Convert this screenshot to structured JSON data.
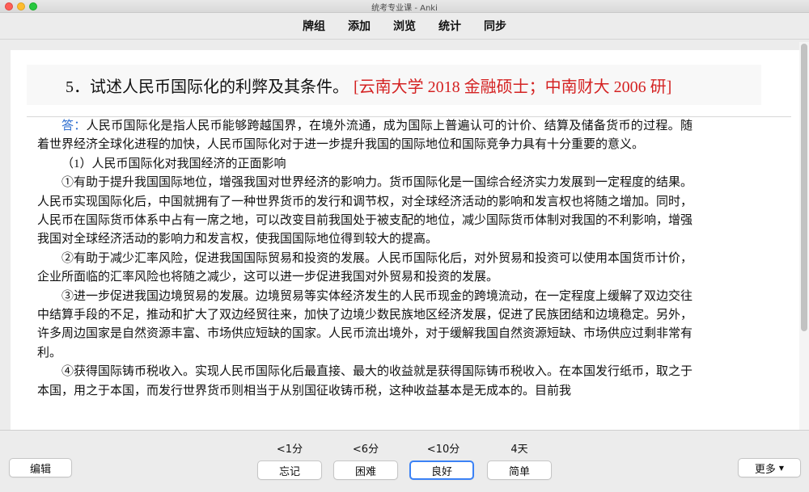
{
  "window": {
    "title": "统考专业课 - Anki"
  },
  "nav": {
    "items": [
      "牌组",
      "添加",
      "浏览",
      "统计",
      "同步"
    ]
  },
  "card": {
    "question": "5．试述人民币国际化的利弊及其条件。",
    "source": "[云南大学 2018 金融硕士；中南财大 2006 研]",
    "answer_label": "答：",
    "paragraphs": [
      "人民币国际化是指人民币能够跨越国界，在境外流通，成为国际上普遍认可的计价、结算及储备货币的过程。随着世界经济全球化进程的加快，人民币国际化对于进一步提升我国的国际地位和国际竞争力具有十分重要的意义。",
      "（1）人民币国际化对我国经济的正面影响",
      "①有助于提升我国国际地位，增强我国对世界经济的影响力。货币国际化是一国综合经济实力发展到一定程度的结果。人民币实现国际化后，中国就拥有了一种世界货币的发行和调节权，对全球经济活动的影响和发言权也将随之增加。同时，人民币在国际货币体系中占有一席之地，可以改变目前我国处于被支配的地位，减少国际货币体制对我国的不利影响，增强我国对全球经济活动的影响力和发言权，使我国国际地位得到较大的提高。",
      "②有助于减少汇率风险，促进我国国际贸易和投资的发展。人民币国际化后，对外贸易和投资可以使用本国货币计价，企业所面临的汇率风险也将随之减少，这可以进一步促进我国对外贸易和投资的发展。",
      "③进一步促进我国边境贸易的发展。边境贸易等实体经济发生的人民币现金的跨境流动，在一定程度上缓解了双边交往中结算手段的不足，推动和扩大了双边经贸往来，加快了边境少数民族地区经济发展，促进了民族团结和边境稳定。另外，许多周边国家是自然资源丰富、市场供应短缺的国家。人民币流出境外，对于缓解我国自然资源短缺、市场供应过剩非常有利。",
      "④获得国际铸币税收入。实现人民币国际化后最直接、最大的收益就是获得国际铸币税收入。在本国发行纸币，取之于本国，用之于本国，而发行世界货币则相当于从别国征收铸币税，这种收益基本是无成本的。目前我"
    ]
  },
  "bottom": {
    "edit_label": "编辑",
    "more_label": "更多",
    "answers": [
      {
        "interval": "<1分",
        "label": "忘记"
      },
      {
        "interval": "<6分",
        "label": "困难"
      },
      {
        "interval": "<10分",
        "label": "良好"
      },
      {
        "interval": "4天",
        "label": "简单"
      }
    ]
  },
  "colors": {
    "source_red": "#d42222",
    "answer_label_blue": "#2f6fd0",
    "focus_blue": "#3b82f6"
  }
}
